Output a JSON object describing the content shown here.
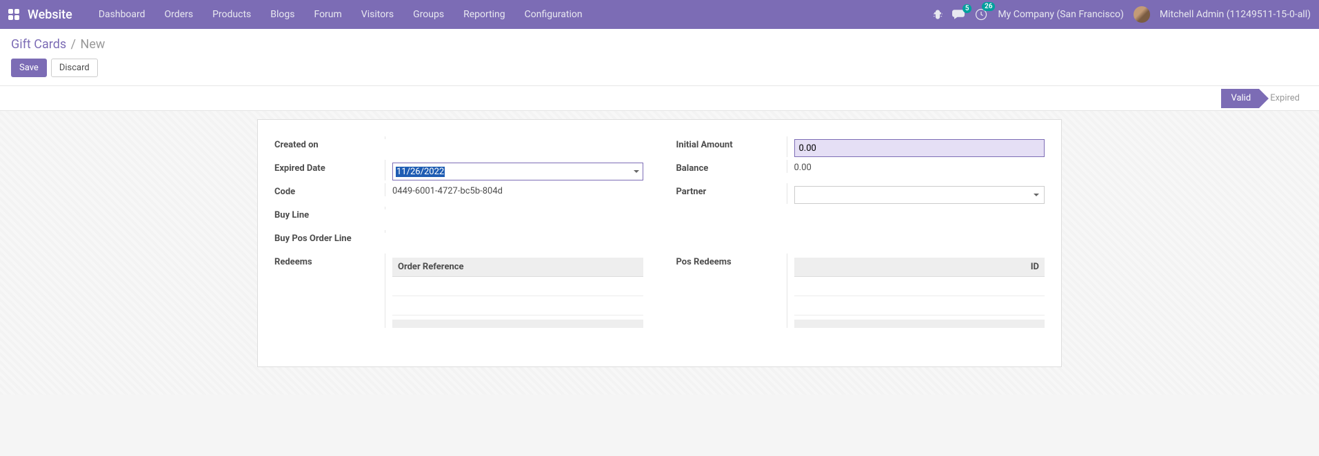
{
  "navbar": {
    "brand": "Website",
    "menu": [
      "Dashboard",
      "Orders",
      "Products",
      "Blogs",
      "Forum",
      "Visitors",
      "Groups",
      "Reporting",
      "Configuration"
    ],
    "chat_badge": "5",
    "activity_badge": "26",
    "company": "My Company (San Francisco)",
    "username": "Mitchell Admin (11249511-15-0-all)"
  },
  "control": {
    "breadcrumb_root": "Gift Cards",
    "breadcrumb_current": "New",
    "save": "Save",
    "discard": "Discard"
  },
  "status": {
    "active": "Valid",
    "inactive": "Expired"
  },
  "form": {
    "labels": {
      "created_on": "Created on",
      "expired_date": "Expired Date",
      "code": "Code",
      "buy_line": "Buy Line",
      "buy_pos_order_line": "Buy Pos Order Line",
      "redeems": "Redeems",
      "initial_amount": "Initial Amount",
      "balance": "Balance",
      "partner": "Partner",
      "pos_redeems": "Pos Redeems"
    },
    "values": {
      "expired_date": "11/26/2022",
      "code": "0449-6001-4727-bc5b-804d",
      "initial_amount": "0.00",
      "balance": "0.00"
    },
    "subtables": {
      "redeems_header": "Order Reference",
      "pos_redeems_header": "ID"
    }
  }
}
